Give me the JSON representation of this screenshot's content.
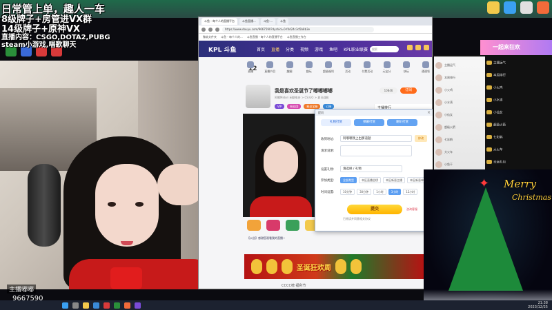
{
  "overlay": {
    "line1": "日常管上单，趣人一车",
    "line2": "8级牌子+房管进VX群",
    "line3": "14级牌子+原神VX",
    "line4": "直播内容：CSGO,DOTA2,PUBG",
    "line5": "steam小游戏,唱歌聊天"
  },
  "webcam": {
    "name_label": "主播嘟嘟",
    "room_id": "9667590"
  },
  "browser": {
    "tabs": [
      "斗鱼 - 每个人的直播平台",
      "斗鱼直播...",
      "斗鱼-...",
      "斗鱼"
    ],
    "url": "https://www.douyu.com/9667590?dyshid=0-f4d24c3d5b8b3e",
    "bookmarks": [
      "微软文件夹",
      "斗鱼 - 每个人的...",
      "斗鱼直播 - 每个人的直播平台",
      "斗鱼直播工作台"
    ]
  },
  "site": {
    "logo": "KPL 斗鱼",
    "nav": [
      "首页",
      "直播",
      "分类",
      "视频",
      "游戏",
      "鱼吧",
      "KPL职业联赛"
    ],
    "nav_active_index": 1,
    "search_placeholder": "搜索",
    "categories": [
      "直播",
      "直播节目",
      "趣圈",
      "趣玩",
      "超级福利",
      "活动",
      "付费活动",
      "元宝分",
      "快玩",
      "通通领",
      "更多"
    ],
    "date": "12"
  },
  "room": {
    "title": "我是喜欢圣诞节了嘟嘟嘟嘟",
    "meta": "阿嘟Midori  闲聊电台 > CS:GO > 夏日战舰",
    "follow_label": "订阅",
    "count_label": "10846",
    "tags": [
      "VIP",
      "粉丝团",
      "粉丝宝箱",
      "订阅"
    ]
  },
  "rank_panel": {
    "title": "主播排行",
    "tabs": [
      "贡献榜",
      "本周榜",
      "粉丝团"
    ]
  },
  "player": {
    "caption": "【公告】感谢您观看我的直播~"
  },
  "banner": {
    "text": "圣诞狂欢周"
  },
  "bottom_text": "CCCC榜    福利节",
  "dialog": {
    "title": "提问",
    "tabs": [
      "礼物打赏",
      "弹幕打赏",
      "喇叭打赏"
    ],
    "active_tab": 0,
    "row1_label": "收到地址:",
    "row1_value": "阿嘟嘟我上出那道题",
    "row1_button": "修改",
    "row2_label": "请求说明:",
    "row3_label": "设置礼物:",
    "row3_value": "请选择 / 礼物",
    "row4_label": "参加类型:",
    "row4_chips": [
      "全部类型",
      "本区直播总榜",
      "本区新晋主播",
      "本区新晋单榜",
      "本区人气总榜"
    ],
    "row4_selected": 0,
    "row5_label": "时间设置:",
    "row5_chips": [
      "10分钟",
      "30分钟",
      "1小时",
      "3小时",
      "12小时"
    ],
    "row5_selected": 3,
    "submit_label": "提交",
    "link_label": "咨询客服",
    "consent": "已阅读并同意相关协议"
  },
  "chat": {
    "items": [
      "主播运气",
      "本周排行",
      "小火鸡",
      "小水滴",
      "小仙女",
      "超级火箭",
      "七彩鹤",
      "大火车",
      "小鱼干",
      "幸运礼包"
    ],
    "ad": "一起来狂欢"
  },
  "xmas": {
    "merry": "Merry",
    "christmas": "Christmas"
  },
  "taskbar": {
    "time": "21:38",
    "date": "2023/12/25"
  },
  "colors": {
    "site_header": "#2b2f7a",
    "accent_orange": "#ff6b1a",
    "dialog_tab": "#63a3f2",
    "submit_yellow": "#ffb400",
    "dress_red": "#c71a1a"
  }
}
